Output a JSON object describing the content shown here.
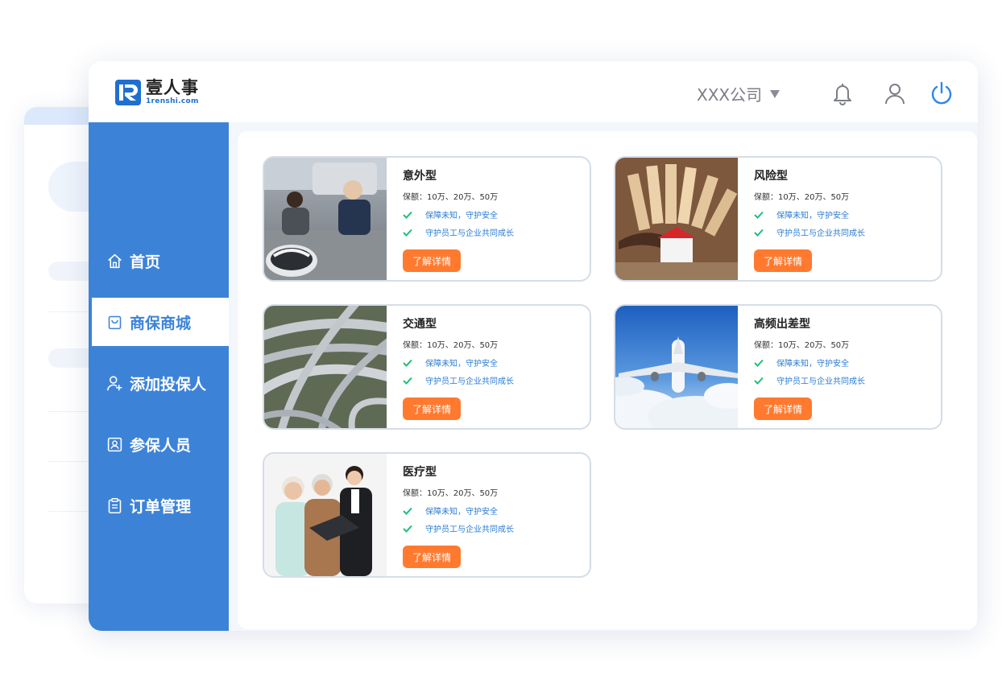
{
  "app": {
    "logo_cn": "壹人事",
    "logo_en": "1renshi.com",
    "brand_color": "#3c83d8",
    "accent_color": "#ff7a2f"
  },
  "header": {
    "company": "XXX公司",
    "icons": [
      "bell-icon",
      "user-icon",
      "power-icon"
    ]
  },
  "sidebar": {
    "items": [
      {
        "label": "首页",
        "icon": "home-icon",
        "active": false
      },
      {
        "label": "商保商城",
        "icon": "shopping-bag-icon",
        "active": true
      },
      {
        "label": "添加投保人",
        "icon": "add-user-icon",
        "active": false
      },
      {
        "label": "参保人员",
        "icon": "id-card-icon",
        "active": false
      },
      {
        "label": "订单管理",
        "icon": "clipboard-icon",
        "active": false
      }
    ]
  },
  "products": [
    {
      "title": "意外型",
      "coverage": "保额：10万、20万、50万",
      "features": [
        "保障未知，守护安全",
        "守护员工与企业共同成长"
      ],
      "button": "了解详情"
    },
    {
      "title": "风险型",
      "coverage": "保额：10万、20万、50万",
      "features": [
        "保障未知，守护安全",
        "守护员工与企业共同成长"
      ],
      "button": "了解详情"
    },
    {
      "title": "交通型",
      "coverage": "保额：10万、20万、50万",
      "features": [
        "保障未知，守护安全",
        "守护员工与企业共同成长"
      ],
      "button": "了解详情"
    },
    {
      "title": "高频出差型",
      "coverage": "保额：10万、20万、50万",
      "features": [
        "保障未知，守护安全",
        "守护员工与企业共同成长"
      ],
      "button": "了解详情"
    },
    {
      "title": "医疗型",
      "coverage": "保额：10万、20万、50万",
      "features": [
        "保障未知，守护安全",
        "守护员工与企业共同成长"
      ],
      "button": "了解详情"
    }
  ]
}
